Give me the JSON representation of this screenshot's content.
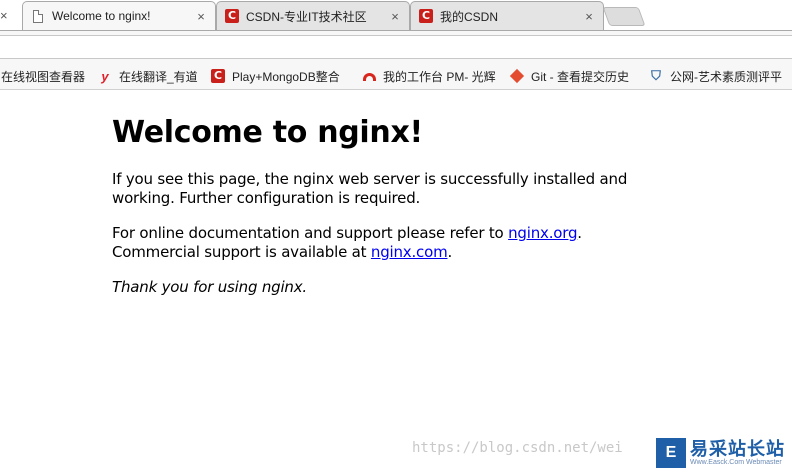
{
  "tabs": [
    {
      "title": "Welcome to nginx!",
      "close": "×",
      "icon": "page-icon"
    },
    {
      "title": "CSDN-专业IT技术社区",
      "close": "×",
      "icon": "csdn-icon"
    },
    {
      "title": "我的CSDN",
      "close": "×",
      "icon": "csdn-icon"
    }
  ],
  "left_close": "×",
  "bookmarks": [
    {
      "label": "在线视图查看器",
      "icon": "none"
    },
    {
      "label": "在线翻译_有道",
      "icon": "youdao-icon",
      "glyph": "y"
    },
    {
      "label": "Play+MongoDB整合",
      "icon": "csdn-icon",
      "glyph": "C"
    },
    {
      "label": "我的工作台 PM- 光辉",
      "icon": "arc-icon"
    },
    {
      "label": "Git - 查看提交历史",
      "icon": "git-icon"
    },
    {
      "label": "公网-艺术素质测评平",
      "icon": "shield-icon",
      "glyph": "⛉"
    }
  ],
  "csdn_glyph": "C",
  "page": {
    "heading": "Welcome to nginx!",
    "p1": "If you see this page, the nginx web server is successfully installed and working. Further configuration is required.",
    "p2_prefix": "For online documentation and support please refer to ",
    "p2_link": "nginx.org",
    "p2_mid": ".",
    "p2_line2_prefix": "Commercial support is available at ",
    "p2_link2": "nginx.com",
    "p2_suffix": ".",
    "p3": "Thank you for using nginx."
  },
  "watermark": {
    "url": "https://blog.csdn.net/wei",
    "logo_cn": "易采站长站",
    "logo_en": "Www.Easck.Com  Webmaster",
    "logo_glyph": "E"
  },
  "colors": {
    "link": "#0000ee",
    "csdn_red": "#c9201c",
    "logo_blue": "#1e5fa8"
  }
}
